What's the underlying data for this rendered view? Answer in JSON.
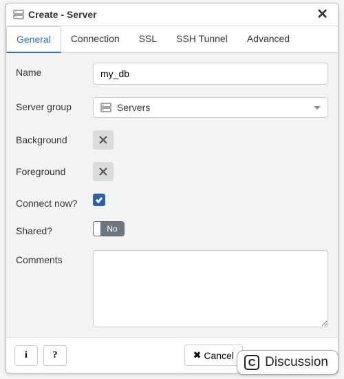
{
  "dialog": {
    "title": "Create - Server",
    "tabs": [
      {
        "label": "General",
        "active": true
      },
      {
        "label": "Connection",
        "active": false
      },
      {
        "label": "SSL",
        "active": false
      },
      {
        "label": "SSH Tunnel",
        "active": false
      },
      {
        "label": "Advanced",
        "active": false
      }
    ],
    "fields": {
      "name": {
        "label": "Name",
        "value": "my_db"
      },
      "server_group": {
        "label": "Server group",
        "value": "Servers"
      },
      "background": {
        "label": "Background",
        "value": null
      },
      "foreground": {
        "label": "Foreground",
        "value": null
      },
      "connect_now": {
        "label": "Connect now?",
        "checked": true
      },
      "shared": {
        "label": "Shared?",
        "value": "No"
      },
      "comments": {
        "label": "Comments",
        "value": ""
      }
    },
    "footer": {
      "info_icon": "i",
      "help_icon": "?",
      "cancel": "Cancel"
    }
  },
  "discussion_badge": {
    "icon_letter": "C",
    "label": "Discussion"
  }
}
